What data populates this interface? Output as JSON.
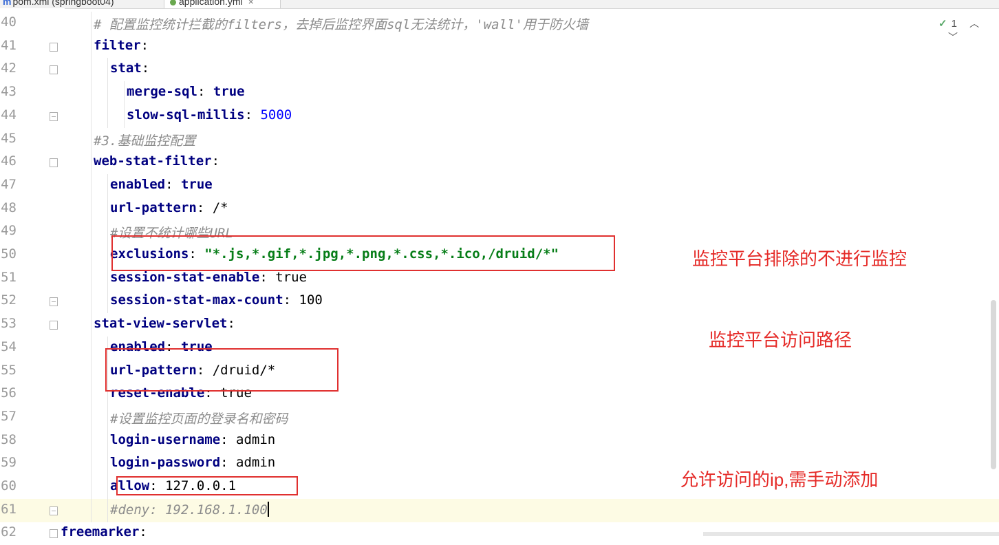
{
  "tabs": [
    {
      "label": "pom.xml (springboot04)",
      "icon": "maven-icon"
    },
    {
      "label": "application.yml",
      "icon": "yaml-icon",
      "active": true
    }
  ],
  "inspection": {
    "check": "✓",
    "count": "1"
  },
  "lines": [
    {
      "n": "40",
      "indent": 3,
      "parts": [
        {
          "t": "# 配置监控统计拦截的filters，去掉后监控界面sql无法统计，'wall'用于防火墙",
          "c": "cm"
        }
      ]
    },
    {
      "n": "41",
      "indent": 3,
      "fold": "start",
      "parts": [
        {
          "t": "filter",
          "c": "k"
        },
        {
          "t": ":",
          "c": "v"
        }
      ]
    },
    {
      "n": "42",
      "indent": 4,
      "fold": "start",
      "parts": [
        {
          "t": "stat",
          "c": "k"
        },
        {
          "t": ":",
          "c": "v"
        }
      ]
    },
    {
      "n": "43",
      "indent": 5,
      "parts": [
        {
          "t": "merge-sql",
          "c": "k"
        },
        {
          "t": ": ",
          "c": "v"
        },
        {
          "t": "true",
          "c": "k"
        }
      ]
    },
    {
      "n": "44",
      "indent": 5,
      "fold": "end",
      "parts": [
        {
          "t": "slow-sql-millis",
          "c": "k"
        },
        {
          "t": ": ",
          "c": "v"
        },
        {
          "t": "5000",
          "c": "num"
        }
      ]
    },
    {
      "n": "45",
      "indent": 3,
      "parts": [
        {
          "t": "#3.基础监控配置",
          "c": "cm"
        }
      ]
    },
    {
      "n": "46",
      "indent": 3,
      "fold": "start",
      "parts": [
        {
          "t": "web-stat-filter",
          "c": "k"
        },
        {
          "t": ":",
          "c": "v"
        }
      ]
    },
    {
      "n": "47",
      "indent": 4,
      "parts": [
        {
          "t": "enabled",
          "c": "k"
        },
        {
          "t": ": ",
          "c": "v"
        },
        {
          "t": "true",
          "c": "k"
        }
      ]
    },
    {
      "n": "48",
      "indent": 4,
      "parts": [
        {
          "t": "url-pattern",
          "c": "k"
        },
        {
          "t": ": /*",
          "c": "v"
        }
      ]
    },
    {
      "n": "49",
      "indent": 4,
      "parts": [
        {
          "t": "#设置不统计哪些URL",
          "c": "cm"
        }
      ]
    },
    {
      "n": "50",
      "indent": 4,
      "parts": [
        {
          "t": "exclusions",
          "c": "k"
        },
        {
          "t": ": ",
          "c": "v"
        },
        {
          "t": "\"*.js,*.gif,*.jpg,*.png,*.css,*.ico,/druid/*\"",
          "c": "str"
        }
      ]
    },
    {
      "n": "51",
      "indent": 4,
      "parts": [
        {
          "t": "session-stat-enable",
          "c": "k"
        },
        {
          "t": ": true",
          "c": "v"
        }
      ]
    },
    {
      "n": "52",
      "indent": 4,
      "fold": "end",
      "parts": [
        {
          "t": "session-stat-max-count",
          "c": "k"
        },
        {
          "t": ": 100",
          "c": "v"
        }
      ]
    },
    {
      "n": "53",
      "indent": 3,
      "fold": "start",
      "parts": [
        {
          "t": "stat-view-servlet",
          "c": "k"
        },
        {
          "t": ":",
          "c": "v"
        }
      ]
    },
    {
      "n": "54",
      "indent": 4,
      "parts": [
        {
          "t": "enabled",
          "c": "k"
        },
        {
          "t": ": ",
          "c": "v"
        },
        {
          "t": "true",
          "c": "k"
        }
      ]
    },
    {
      "n": "55",
      "indent": 4,
      "parts": [
        {
          "t": "url-pattern",
          "c": "k"
        },
        {
          "t": ": /druid/*",
          "c": "v"
        }
      ]
    },
    {
      "n": "56",
      "indent": 4,
      "parts": [
        {
          "t": "reset-enable",
          "c": "k"
        },
        {
          "t": ": true",
          "c": "v"
        }
      ]
    },
    {
      "n": "57",
      "indent": 4,
      "parts": [
        {
          "t": "#设置监控页面的登录名和密码",
          "c": "cm"
        }
      ]
    },
    {
      "n": "58",
      "indent": 4,
      "parts": [
        {
          "t": "login-username",
          "c": "k"
        },
        {
          "t": ": admin",
          "c": "v"
        }
      ]
    },
    {
      "n": "59",
      "indent": 4,
      "parts": [
        {
          "t": "login-password",
          "c": "k"
        },
        {
          "t": ": admin",
          "c": "v"
        }
      ]
    },
    {
      "n": "60",
      "indent": 4,
      "parts": [
        {
          "t": "allow",
          "c": "k"
        },
        {
          "t": ": 127.0.0.1",
          "c": "v"
        }
      ]
    },
    {
      "n": "61",
      "indent": 4,
      "fold": "end",
      "current": true,
      "caret": true,
      "parts": [
        {
          "t": "#deny: 192.168.1.100",
          "c": "cm"
        }
      ]
    },
    {
      "n": "62",
      "indent": 1,
      "fold": "start",
      "parts": [
        {
          "t": "freemarker",
          "c": "k"
        },
        {
          "t": ":",
          "c": "v"
        }
      ]
    }
  ],
  "annotations": {
    "exclusions_note": "监控平台排除的不进行监控",
    "path_note": "监控平台访问路径",
    "allow_note": "允许访问的ip,需手动添加"
  },
  "colors": {
    "keyword": "#000080",
    "string": "#067d17",
    "number": "#0000ff",
    "comment": "#8c8c8c",
    "annotation_red": "#e52b28",
    "current_line": "#fdfbe4"
  }
}
